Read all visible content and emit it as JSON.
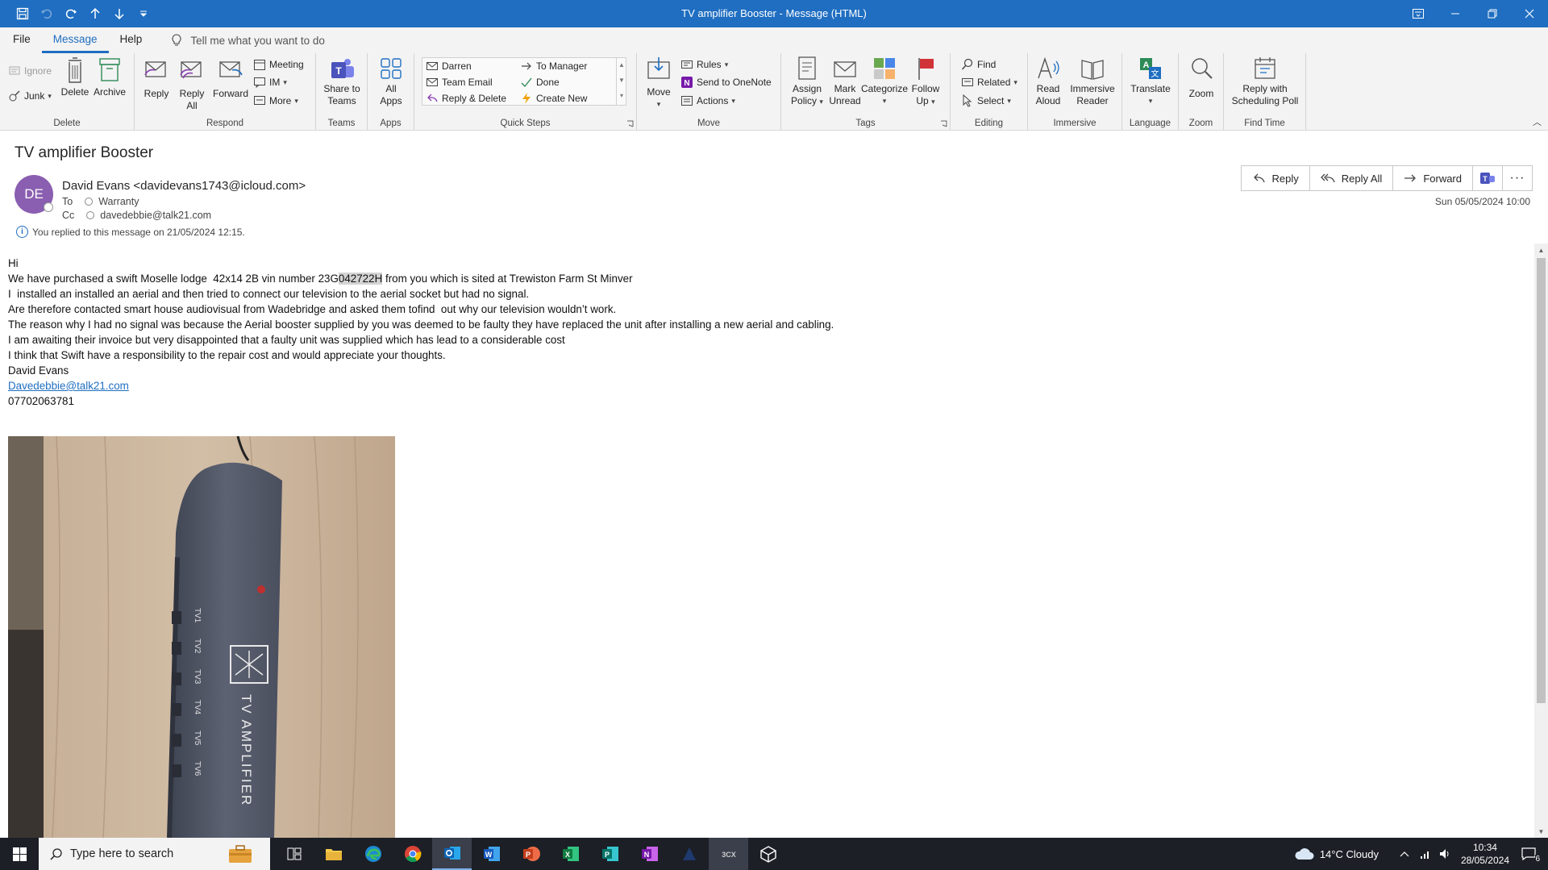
{
  "window": {
    "title": "TV amplifier Booster  -  Message (HTML)"
  },
  "tabs": [
    {
      "label": "File"
    },
    {
      "label": "Message"
    },
    {
      "label": "Help"
    }
  ],
  "tell_me": {
    "placeholder": "Tell me what you want to do"
  },
  "ribbon": {
    "delete": {
      "group": "Delete",
      "ignore": "Ignore",
      "junk": "Junk",
      "delete": "Delete",
      "archive": "Archive"
    },
    "respond": {
      "group": "Respond",
      "reply": "Reply",
      "reply_all_1": "Reply",
      "reply_all_2": "All",
      "forward": "Forward",
      "meeting": "Meeting",
      "im": "IM",
      "more": "More"
    },
    "teams": {
      "group": "Teams",
      "share_1": "Share to",
      "share_2": "Teams"
    },
    "apps": {
      "group": "Apps",
      "all_1": "All",
      "all_2": "Apps"
    },
    "quick_steps": {
      "group": "Quick Steps",
      "items": [
        "Darren",
        "To Manager",
        "Team Email",
        "Done",
        "Reply & Delete",
        "Create New"
      ]
    },
    "move": {
      "group": "Move",
      "move": "Move",
      "rules": "Rules",
      "onenote": "Send to OneNote",
      "actions": "Actions"
    },
    "tags": {
      "group": "Tags",
      "assign_1": "Assign",
      "assign_2": "Policy",
      "mark_1": "Mark",
      "mark_2": "Unread",
      "categorize": "Categorize",
      "follow_1": "Follow",
      "follow_2": "Up"
    },
    "editing": {
      "group": "Editing",
      "find": "Find",
      "related": "Related",
      "select": "Select"
    },
    "immersive": {
      "group": "Immersive",
      "read_1": "Read",
      "read_2": "Aloud",
      "imm_1": "Immersive",
      "imm_2": "Reader"
    },
    "language": {
      "group": "Language",
      "translate": "Translate"
    },
    "zoom": {
      "group": "Zoom",
      "zoom": "Zoom"
    },
    "find_time": {
      "group": "Find Time",
      "poll_1": "Reply with",
      "poll_2": "Scheduling Poll"
    }
  },
  "message": {
    "subject": "TV amplifier Booster",
    "avatar_initials": "DE",
    "sender": "David Evans <davidevans1743@icloud.com>",
    "to_label": "To",
    "to": "Warranty",
    "cc_label": "Cc",
    "cc": "davedebbie@talk21.com",
    "info": "You replied to this message on 21/05/2024 12:15.",
    "sent": "Sun 05/05/2024 10:00",
    "actions": {
      "reply": "Reply",
      "reply_all": "Reply All",
      "forward": "Forward"
    },
    "body": {
      "greeting": "Hi",
      "line1_a": "We have purchased a swift Moselle lodge  42x14 2B vin number 23G",
      "line1_hl": "042722H",
      "line1_b": " from you which is sited at Trewiston Farm St Minver",
      "line2": "I  installed an installed an aerial and then tried to connect our television to the aerial socket but had no signal.",
      "line3": "Are therefore contacted smart house audiovisual from Wadebridge and asked them tofind  out why our television wouldn’t work.",
      "line4": "The reason why I had no signal was because the Aerial booster supplied by you was deemed to be faulty they have replaced the unit after installing a new aerial and cabling.",
      "line5": "I am awaiting their invoice but very disappointed that a faulty unit was supplied which has lead to a considerable cost",
      "line6": "I think that Swift have a responsibility to the repair cost and would appreciate your thoughts.",
      "signature_name": "David Evans",
      "signature_email": "Davedebbie@talk21.com",
      "signature_phone": "07702063781"
    },
    "photo": {
      "device_label": "TV AMPLIFIER",
      "ports": [
        "TV1",
        "TV2",
        "TV3",
        "TV4",
        "TV5",
        "TV6"
      ]
    }
  },
  "taskbar": {
    "search_placeholder": "Type here to search",
    "weather": "14°C  Cloudy",
    "time": "10:34",
    "date": "28/05/2024",
    "notifications": "6"
  },
  "colors": {
    "accent": "#1f6ec1",
    "avatar": "#8a5eb0",
    "taskbar": "#1c1f26"
  }
}
